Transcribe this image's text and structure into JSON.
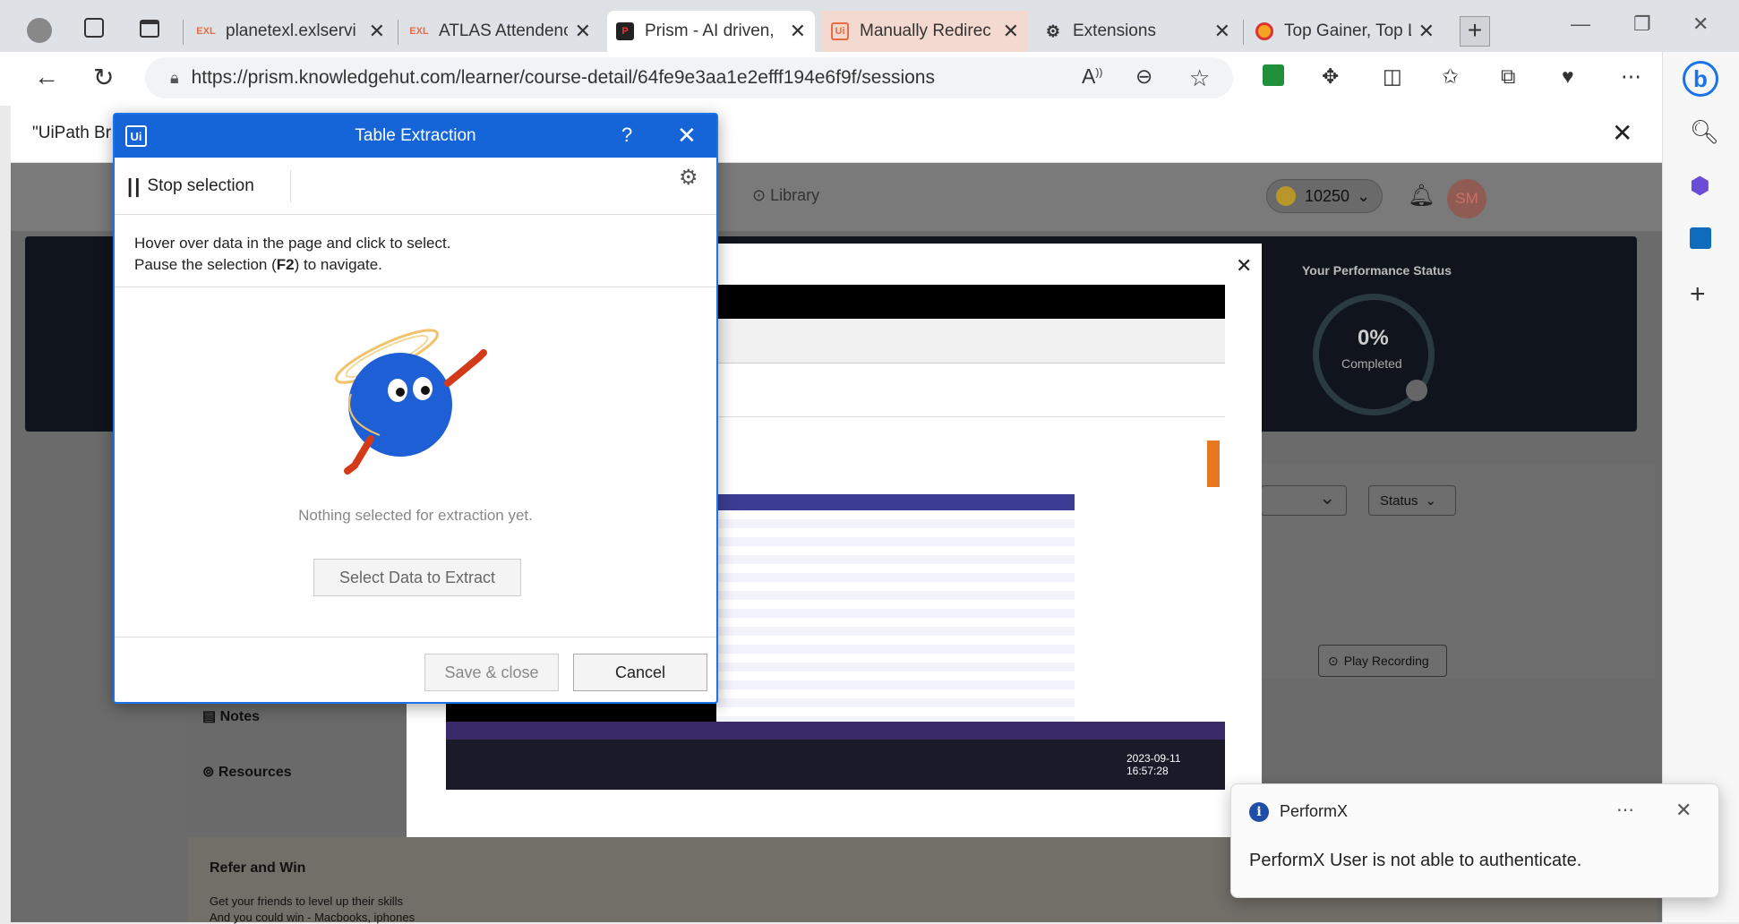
{
  "browser": {
    "tabs": [
      {
        "label": "planetexl.exlservi",
        "favicon": "EXL"
      },
      {
        "label": "ATLAS Attendenc",
        "favicon": "EXL"
      },
      {
        "label": "Prism - AI driven,",
        "favicon": "P"
      },
      {
        "label": "Manually Redirec",
        "favicon": "Ui"
      },
      {
        "label": "Extensions",
        "favicon": "puzzle-icon"
      },
      {
        "label": "Top Gainer, Top L",
        "favicon": "circle"
      }
    ],
    "url": "https://prism.knowledgehut.com/learner/course-detail/64fe9e3aa1e2efff194e6f9f/sessions"
  },
  "page": {
    "notification_title": "\"UiPath Br",
    "library_label": "Library",
    "points": "10250",
    "avatar_initials": "SM",
    "performance_title": "Your Performance Status",
    "performance_value": "0%",
    "performance_sub": "Completed",
    "status_label": "Status",
    "play_recording": "Play Recording",
    "notes_label": "Notes",
    "resources_label": "Resources",
    "refer_title": "Refer and Win",
    "refer_text": "Get your friends to level up their skills",
    "refer_text2": "And you could win - Macbooks, iphones",
    "video_timestamp": "2023-09-11 16:57:28"
  },
  "dialog": {
    "title": "Table Extraction",
    "stop_selection": "Stop selection",
    "instruction_line1": "Hover over data in the page and click to select.",
    "instruction_line2_pre": "Pause the selection (",
    "instruction_key": "F2",
    "instruction_line2_post": ") to navigate.",
    "empty_message": "Nothing selected for extraction yet.",
    "select_button": "Select Data to Extract",
    "save_button": "Save & close",
    "cancel_button": "Cancel"
  },
  "toast": {
    "app_name": "PerformX",
    "message": "PerformX User is not able to authenticate."
  },
  "colors": {
    "uipath_blue": "#1565d8",
    "mascot_blue": "#1f5fd6",
    "toast_icon": "#1f4ea8"
  }
}
